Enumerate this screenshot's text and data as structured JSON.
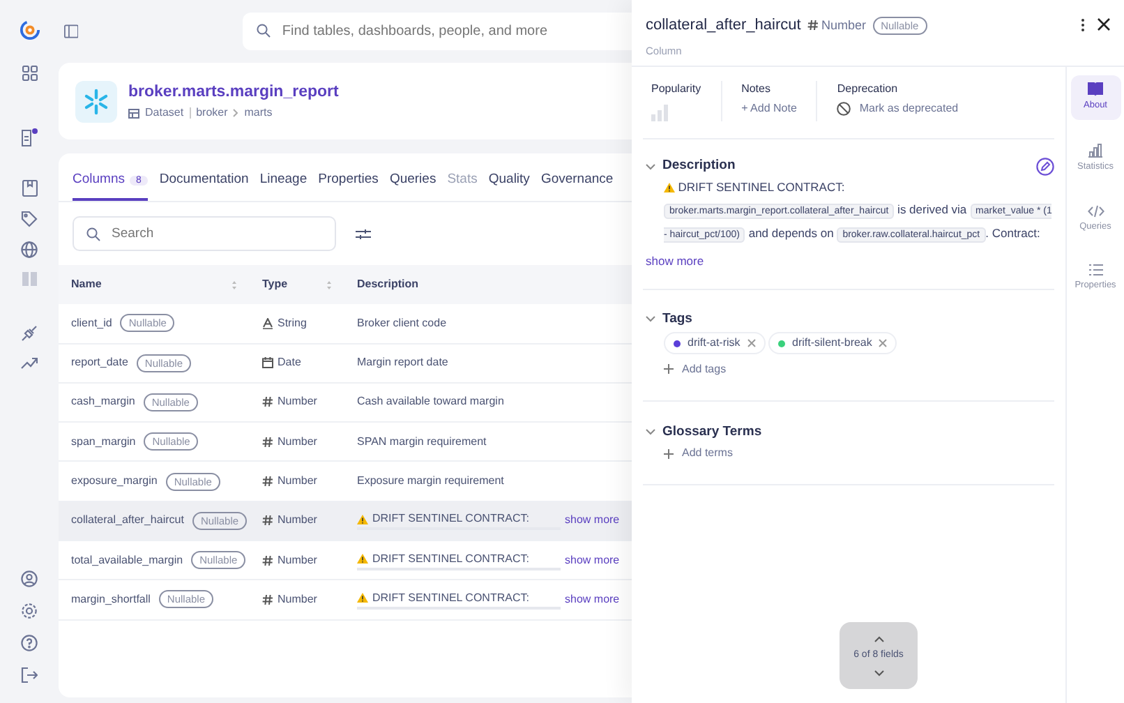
{
  "notifications": {
    "unread": true
  },
  "search": {
    "placeholder": "Find tables, dashboards, people, and more"
  },
  "dataset": {
    "name": "broker.marts.margin_report",
    "type_label": "Dataset",
    "path": [
      "broker",
      "marts"
    ]
  },
  "tabs": [
    {
      "label": "Columns",
      "count": "8",
      "selected": true,
      "disabled": false
    },
    {
      "label": "Documentation",
      "selected": false,
      "disabled": false
    },
    {
      "label": "Lineage",
      "selected": false,
      "disabled": false
    },
    {
      "label": "Properties",
      "selected": false,
      "disabled": false
    },
    {
      "label": "Queries",
      "selected": false,
      "disabled": false
    },
    {
      "label": "Stats",
      "selected": false,
      "disabled": true
    },
    {
      "label": "Quality",
      "selected": false,
      "disabled": false
    },
    {
      "label": "Governance",
      "selected": false,
      "disabled": false
    }
  ],
  "column_search": {
    "placeholder": "Search"
  },
  "table": {
    "columns": [
      "Name",
      "Type",
      "Description"
    ],
    "rows": [
      {
        "name": "client_id",
        "badge": "Nullable",
        "type": {
          "kind": "string",
          "label": "String"
        },
        "description": "Broker client code",
        "warning": false,
        "selected": false
      },
      {
        "name": "report_date",
        "badge": "Nullable",
        "type": {
          "kind": "date",
          "label": "Date"
        },
        "description": "Margin report date",
        "warning": false,
        "selected": false
      },
      {
        "name": "cash_margin",
        "badge": "Nullable",
        "type": {
          "kind": "number",
          "label": "Number"
        },
        "description": "Cash available toward margin",
        "warning": false,
        "selected": false
      },
      {
        "name": "span_margin",
        "badge": "Nullable",
        "type": {
          "kind": "number",
          "label": "Number"
        },
        "description": "SPAN margin requirement",
        "warning": false,
        "selected": false
      },
      {
        "name": "exposure_margin",
        "badge": "Nullable",
        "type": {
          "kind": "number",
          "label": "Number"
        },
        "description": "Exposure margin requirement",
        "warning": false,
        "selected": false
      },
      {
        "name": "collateral_after_haircut",
        "badge": "Nullable",
        "type": {
          "kind": "number",
          "label": "Number"
        },
        "description": "DRIFT SENTINEL CONTRACT:",
        "warning": true,
        "more": "show more",
        "selected": true
      },
      {
        "name": "total_available_margin",
        "badge": "Nullable",
        "type": {
          "kind": "number",
          "label": "Number"
        },
        "description": "DRIFT SENTINEL CONTRACT:",
        "warning": true,
        "more": "show more",
        "selected": false
      },
      {
        "name": "margin_shortfall",
        "badge": "Nullable",
        "type": {
          "kind": "number",
          "label": "Number"
        },
        "description": "DRIFT SENTINEL CONTRACT:",
        "warning": true,
        "more": "show more",
        "selected": false
      }
    ]
  },
  "drawer": {
    "title": "collateral_after_haircut",
    "type": {
      "kind": "number",
      "label": "Number"
    },
    "badge": "Nullable",
    "subtitle": "Column",
    "popularity": {
      "label": "Popularity"
    },
    "notes": {
      "label": "Notes",
      "action": "+ Add Note"
    },
    "deprecation": {
      "label": "Deprecation",
      "action": "Mark as deprecated"
    },
    "description": {
      "title": "Description",
      "expanded": true,
      "heading": "DRIFT SENTINEL CONTRACT:",
      "body": [
        {
          "kind": "code",
          "text": "broker.marts.margin_report.collateral_after_haircut"
        },
        {
          "kind": "text",
          "text": " is derived via "
        },
        {
          "kind": "code",
          "text": "market_value * (1 - haircut_pct/100)"
        },
        {
          "kind": "text",
          "text": " and depends on "
        },
        {
          "kind": "code",
          "text": "broker.raw.collateral.haircut_pct"
        },
        {
          "kind": "text",
          "text": ". Contract:"
        }
      ],
      "more": "show more"
    },
    "tags": {
      "title": "Tags",
      "expanded": true,
      "items": [
        {
          "label": "drift-at-risk",
          "color": "#5b3fd9"
        },
        {
          "label": "drift-silent-break",
          "color": "#3ad17c"
        }
      ],
      "add": "Add tags"
    },
    "glossary": {
      "title": "Glossary Terms",
      "expanded": true,
      "add": "Add terms"
    },
    "side_tabs": [
      {
        "kind": "about",
        "label": "About",
        "selected": true
      },
      {
        "kind": "statistics",
        "label": "Statistics",
        "selected": false
      },
      {
        "kind": "queries",
        "label": "Queries",
        "selected": false
      },
      {
        "kind": "properties",
        "label": "Properties",
        "selected": false
      }
    ],
    "pager": {
      "label": "6 of 8 fields"
    }
  }
}
